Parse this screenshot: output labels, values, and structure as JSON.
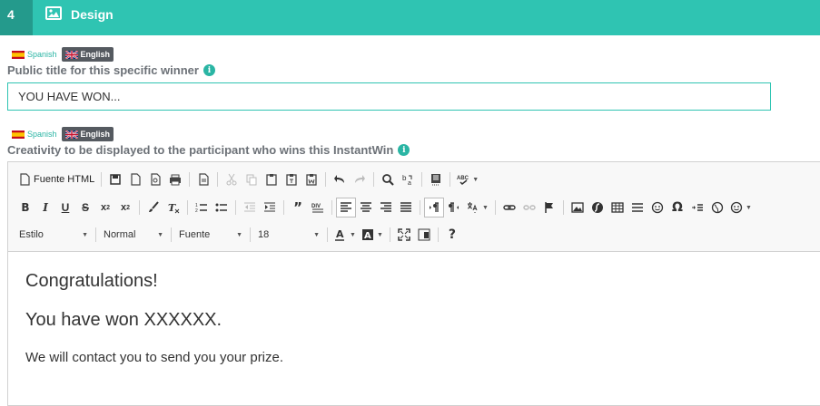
{
  "step": {
    "number": "4",
    "title": "Design",
    "icon": "image-icon"
  },
  "languages": {
    "spanish": "Spanish",
    "english": "English"
  },
  "public_title": {
    "label": "Public title for this specific winner",
    "value": "YOU HAVE WON..."
  },
  "creativity": {
    "label": "Creativity to be displayed to the participant who wins this InstantWin"
  },
  "toolbar": {
    "source_label": "Fuente HTML",
    "style_combo": "Estilo",
    "format_combo": "Normal",
    "font_combo": "Fuente",
    "size_combo": "18",
    "omega": "Ω",
    "help": "?"
  },
  "editor_content": {
    "heading1": "Congratulations!",
    "heading2": "You have won XXXXXX.",
    "paragraph": "We will contact you to send you your prize."
  },
  "colors": {
    "accent": "#2fc4b2",
    "accent_dark": "#249a8c",
    "english_badge": "#555a60"
  }
}
